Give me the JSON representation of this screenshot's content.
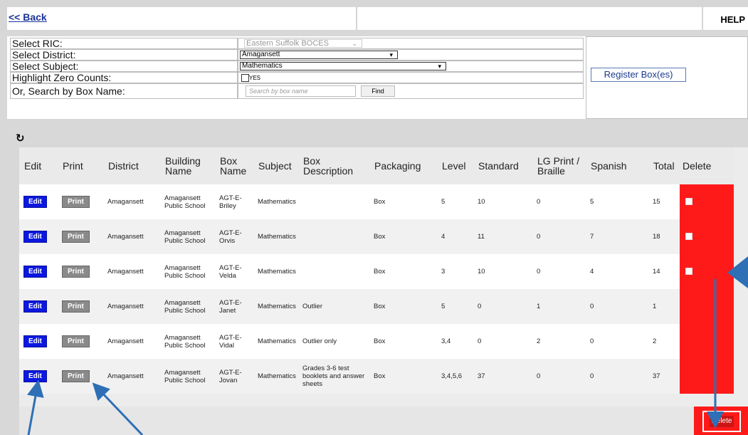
{
  "topbar": {
    "back_label": "<< Back",
    "help_label": "HELP"
  },
  "form": {
    "ric_label": "Select RIC:",
    "ric_value": "Eastern Suffolk BOCES",
    "district_label": "Select District:",
    "district_value": "Amagansett",
    "subject_label": "Select Subject:",
    "subject_value": "Mathematics",
    "zero_label": "Highlight Zero Counts:",
    "zero_option": "YES",
    "search_label": "Or, Search by Box Name:",
    "search_placeholder": "Search by box name",
    "find_label": "Find",
    "register_label": "Register Box(es)"
  },
  "table": {
    "headers": [
      "Edit",
      "Print",
      "District",
      "Building Name",
      "Box Name",
      "Subject",
      "Box Description",
      "Packaging",
      "Level",
      "Standard",
      "LG Print / Braille",
      "Spanish",
      "Total",
      "Delete"
    ],
    "edit_label": "Edit",
    "print_label": "Print",
    "rows": [
      {
        "district": "Amagansett",
        "building": "Amagansett Public School",
        "box": "AGT-E-Briley",
        "subject": "Mathematics",
        "desc": "",
        "packaging": "Box",
        "level": "5",
        "standard": "10",
        "lg": "0",
        "spanish": "5",
        "total": "15",
        "checkbox": true
      },
      {
        "district": "Amagansett",
        "building": "Amagansett Public School",
        "box": "AGT-E-Orvis",
        "subject": "Mathematics",
        "desc": "",
        "packaging": "Box",
        "level": "4",
        "standard": "11",
        "lg": "0",
        "spanish": "7",
        "total": "18",
        "checkbox": true
      },
      {
        "district": "Amagansett",
        "building": "Amagansett Public School",
        "box": "AGT-E-Velda",
        "subject": "Mathematics",
        "desc": "",
        "packaging": "Box",
        "level": "3",
        "standard": "10",
        "lg": "0",
        "spanish": "4",
        "total": "14",
        "checkbox": true
      },
      {
        "district": "Amagansett",
        "building": "Amagansett Public School",
        "box": "AGT-E-Janet",
        "subject": "Mathematics",
        "desc": "Outlier",
        "packaging": "Box",
        "level": "5",
        "standard": "0",
        "lg": "1",
        "spanish": "0",
        "total": "1",
        "checkbox": false
      },
      {
        "district": "Amagansett",
        "building": "Amagansett Public School",
        "box": "AGT-E-Vidal",
        "subject": "Mathematics",
        "desc": "Outlier only",
        "packaging": "Box",
        "level": "3,4",
        "standard": "0",
        "lg": "2",
        "spanish": "0",
        "total": "2",
        "checkbox": false
      },
      {
        "district": "Amagansett",
        "building": "Amagansett Public School",
        "box": "AGT-E-Jovan",
        "subject": "Mathematics",
        "desc": "Grades 3-6 test booklets and answer sheets",
        "packaging": "Box",
        "level": "3,4,5,6",
        "standard": "37",
        "lg": "0",
        "spanish": "0",
        "total": "37",
        "checkbox": false
      }
    ],
    "delete_button": "Delete"
  },
  "colors": {
    "edit": "#0b18e0",
    "print": "#8a8a8a",
    "delete": "#ff1a1a",
    "arrow": "#2e6fb5"
  }
}
